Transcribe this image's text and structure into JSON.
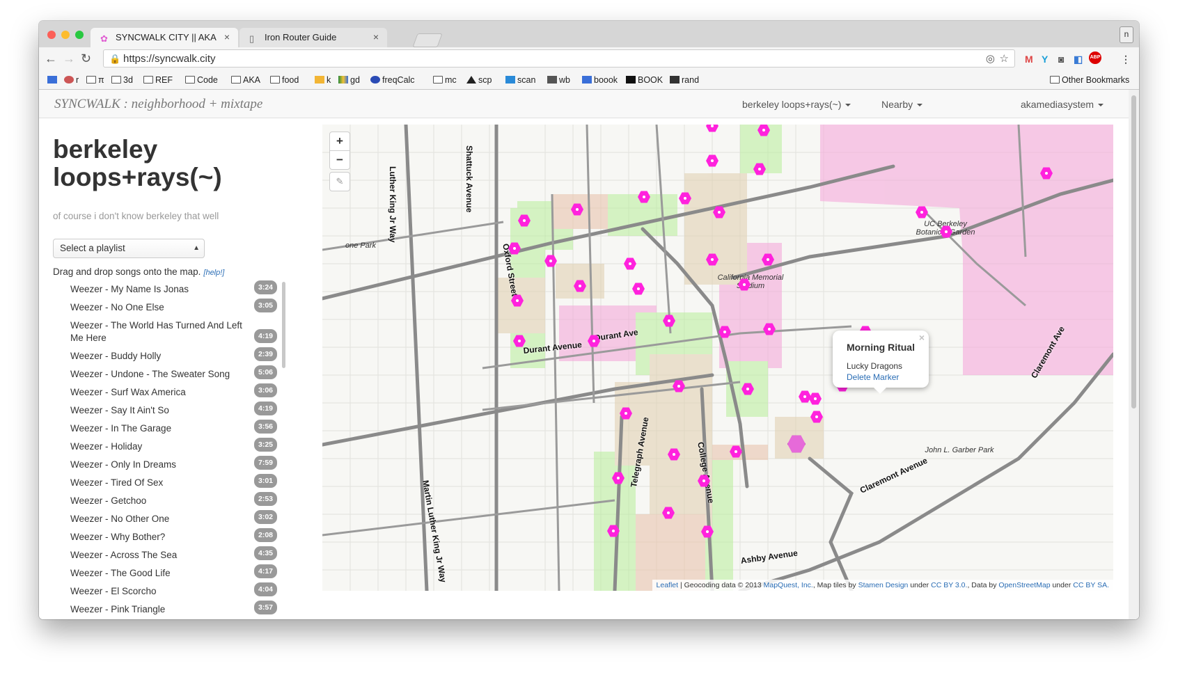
{
  "browser": {
    "tabs": [
      {
        "title": "SYNCWALK CITY || AKA",
        "icon": "flower-icon"
      },
      {
        "title": "Iron Router Guide",
        "icon": "document-icon"
      }
    ],
    "profile_initial": "n",
    "url": "https://syncwalk.city",
    "bookmarks": [
      {
        "label": "",
        "icon": "calendar-icon"
      },
      {
        "label": "r",
        "icon": "gear-icon"
      },
      {
        "label": "π",
        "icon": "folder-icon"
      },
      {
        "label": "3d",
        "icon": "folder-icon"
      },
      {
        "label": "REF",
        "icon": "folder-icon"
      },
      {
        "label": "Code",
        "icon": "folder-icon"
      },
      {
        "label": "AKA",
        "icon": "folder-icon"
      },
      {
        "label": "food",
        "icon": "folder-icon"
      },
      {
        "label": "k",
        "icon": "bulb-icon"
      },
      {
        "label": "gd",
        "icon": "drive-icon"
      },
      {
        "label": "freqCalc",
        "icon": "c-icon"
      },
      {
        "label": "mc",
        "icon": "folder-icon"
      },
      {
        "label": "scp",
        "icon": "a-icon"
      },
      {
        "label": "scan",
        "icon": "scan-icon"
      },
      {
        "label": "wb",
        "icon": "wayback-icon"
      },
      {
        "label": "boook",
        "icon": "doc-icon"
      },
      {
        "label": "BOOK",
        "icon": "book-icon"
      },
      {
        "label": "rand",
        "icon": "hash-icon"
      }
    ],
    "other_bookmarks": "Other Bookmarks"
  },
  "navbar": {
    "brand": "SYNCWALK : neighborhood + mixtape",
    "items": [
      "berkeley loops+rays(~)",
      "Nearby",
      "akamediasystem"
    ]
  },
  "sidebar": {
    "title": "berkeley loops+rays(~)",
    "subtitle": "of course i don't know berkeley that well",
    "select_label": "Select a playlist",
    "hint": "Drag and drop songs onto the map.",
    "help": "[help!]",
    "songs": [
      {
        "title": "Weezer - My Name Is Jonas",
        "duration": "3:24"
      },
      {
        "title": "Weezer - No One Else",
        "duration": "3:05"
      },
      {
        "title": "Weezer - The World Has Turned And Left Me Here",
        "duration": "4:19"
      },
      {
        "title": "Weezer - Buddy Holly",
        "duration": "2:39"
      },
      {
        "title": "Weezer - Undone - The Sweater Song",
        "duration": "5:06"
      },
      {
        "title": "Weezer - Surf Wax America",
        "duration": "3:06"
      },
      {
        "title": "Weezer - Say It Ain't So",
        "duration": "4:19"
      },
      {
        "title": "Weezer - In The Garage",
        "duration": "3:56"
      },
      {
        "title": "Weezer - Holiday",
        "duration": "3:25"
      },
      {
        "title": "Weezer - Only In Dreams",
        "duration": "7:59"
      },
      {
        "title": "Weezer - Tired Of Sex",
        "duration": "3:01"
      },
      {
        "title": "Weezer - Getchoo",
        "duration": "2:53"
      },
      {
        "title": "Weezer - No Other One",
        "duration": "3:02"
      },
      {
        "title": "Weezer - Why Bother?",
        "duration": "2:08"
      },
      {
        "title": "Weezer - Across The Sea",
        "duration": "4:35"
      },
      {
        "title": "Weezer - The Good Life",
        "duration": "4:17"
      },
      {
        "title": "Weezer - El Scorcho",
        "duration": "4:04"
      },
      {
        "title": "Weezer - Pink Triangle",
        "duration": "3:57"
      }
    ]
  },
  "map": {
    "zoom_in": "+",
    "zoom_out": "−",
    "street_labels": [
      "Luther King Jr Way",
      "Shattuck Avenue",
      "Oxford Street",
      "Durant Avenue",
      "Durant Ave",
      "Telegraph Avenue",
      "College Avenue",
      "Martin Luther King Jr Way",
      "Ashby Avenue",
      "Claremont Avenue",
      "Claremont Ave"
    ],
    "place_labels": [
      "one Park",
      "California Memorial Stadium",
      "UC Berkeley Botanical Garden",
      "John L. Garber Park"
    ],
    "popup": {
      "title": "Morning Ritual",
      "close": "×",
      "body": "Lucky Dragons",
      "link": "Delete Marker"
    },
    "attribution": {
      "leaflet": "Leaflet",
      "geocode": "| Geocoding data © 2013",
      "mapquest": "MapQuest, Inc.",
      "tiles": ", Map tiles by",
      "stamen": "Stamen Design",
      "under1": "under",
      "ccby": "CC BY 3.0.",
      "data": ", Data by",
      "osm": "OpenStreetMap",
      "under2": "under",
      "ccbysa": "CC BY SA."
    },
    "colors": {
      "pink_zone": "#f5a3d8",
      "green_zone": "#b8ee9a",
      "tan_zone": "#e0cfae",
      "marker": "#ff22dd"
    }
  }
}
